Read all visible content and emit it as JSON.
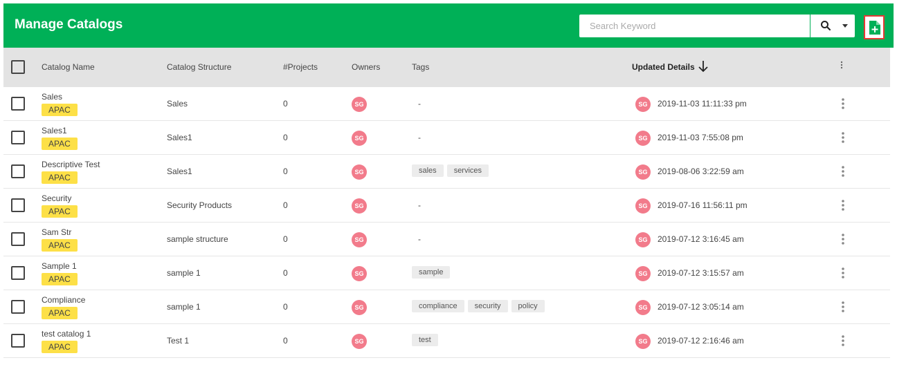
{
  "header": {
    "title": "Manage Catalogs"
  },
  "search": {
    "placeholder": "Search Keyword",
    "value": ""
  },
  "columns": {
    "name": "Catalog Name",
    "structure": "Catalog Structure",
    "projects": "#Projects",
    "owners": "Owners",
    "tags": "Tags",
    "updated": "Updated Details"
  },
  "rows": [
    {
      "name": "Sales",
      "region": "APAC",
      "structure": "Sales",
      "projects": "0",
      "owner": "SG",
      "tags": [],
      "empty_tag": "-",
      "updated_by": "SG",
      "updated": "2019-11-03 11:11:33 pm"
    },
    {
      "name": "Sales1",
      "region": "APAC",
      "structure": "Sales1",
      "projects": "0",
      "owner": "SG",
      "tags": [],
      "empty_tag": "-",
      "updated_by": "SG",
      "updated": "2019-11-03 7:55:08 pm"
    },
    {
      "name": "Descriptive Test",
      "region": "APAC",
      "structure": "Sales1",
      "projects": "0",
      "owner": "SG",
      "tags": [
        "sales",
        "services"
      ],
      "empty_tag": "",
      "updated_by": "SG",
      "updated": "2019-08-06 3:22:59 am"
    },
    {
      "name": "Security",
      "region": "APAC",
      "structure": "Security Products",
      "projects": "0",
      "owner": "SG",
      "tags": [],
      "empty_tag": "-",
      "updated_by": "SG",
      "updated": "2019-07-16 11:56:11 pm"
    },
    {
      "name": "Sam Str",
      "region": "APAC",
      "structure": "sample structure",
      "projects": "0",
      "owner": "SG",
      "tags": [],
      "empty_tag": "-",
      "updated_by": "SG",
      "updated": "2019-07-12 3:16:45 am"
    },
    {
      "name": "Sample 1",
      "region": "APAC",
      "structure": "sample 1",
      "projects": "0",
      "owner": "SG",
      "tags": [
        "sample"
      ],
      "empty_tag": "",
      "updated_by": "SG",
      "updated": "2019-07-12 3:15:57 am"
    },
    {
      "name": "Compliance",
      "region": "APAC",
      "structure": "sample 1",
      "projects": "0",
      "owner": "SG",
      "tags": [
        "compliance",
        "security",
        "policy"
      ],
      "empty_tag": "",
      "updated_by": "SG",
      "updated": "2019-07-12 3:05:14 am"
    },
    {
      "name": "test catalog 1",
      "region": "APAC",
      "structure": "Test 1",
      "projects": "0",
      "owner": "SG",
      "tags": [
        "test"
      ],
      "empty_tag": "",
      "updated_by": "SG",
      "updated": "2019-07-12 2:16:46 am"
    }
  ],
  "colors": {
    "header": "#00b057",
    "region_badge": "#fde047",
    "avatar": "#f27b8b",
    "highlight_border": "#e53935"
  },
  "icons": {
    "search": "search-icon",
    "caret": "caret-down-icon",
    "add": "add-file-icon",
    "sort": "arrow-down-icon",
    "menu": "more-vertical-icon"
  }
}
